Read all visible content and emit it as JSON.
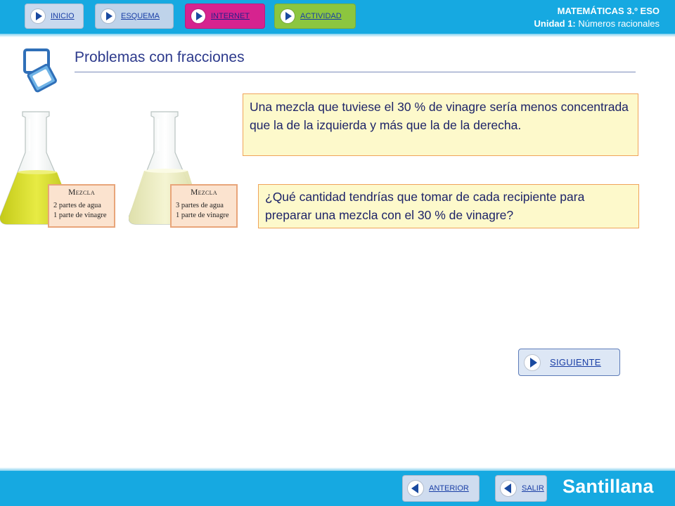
{
  "nav": {
    "inicio": "INICIO",
    "esquema": "ESQUEMA",
    "internet": "INTERNET",
    "actividad": "ACTIVIDAD"
  },
  "course": {
    "subject": "MATEMÁTICAS 3.º ESO",
    "unit_label": "Unidad 1:",
    "unit_name": "Números racionales"
  },
  "page": {
    "title": "Problemas con fracciones"
  },
  "flasks": [
    {
      "heading": "Mezcla",
      "line1": "2 partes de agua",
      "line2": "1 parte de vinagre",
      "liquid_color": "#d6dc1a"
    },
    {
      "heading": "Mezcla",
      "line1": "3 partes de agua",
      "line2": "1 parte de vinagre",
      "liquid_color": "#eeeebb"
    }
  ],
  "content": {
    "statement": "Una mezcla que tuviese el 30 % de vinagre sería menos concentrada que la de la izquierda y más que la de la derecha.",
    "question": "¿Qué cantidad tendrías que tomar de cada recipiente para preparar una mezcla con el 30 % de vinagre?"
  },
  "buttons": {
    "siguiente": "SIGUIENTE",
    "anterior": "ANTERIOR",
    "salir": "SALIR"
  },
  "brand": "Santillana",
  "colors": {
    "bar": "#16a9e1",
    "title": "#2d3a8c",
    "box_bg": "#fdf9cb",
    "box_border": "#f0a45a"
  }
}
